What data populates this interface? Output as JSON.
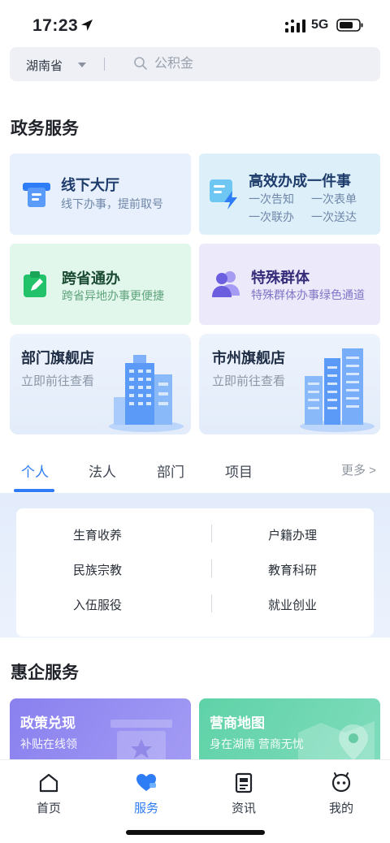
{
  "status_bar": {
    "time": "17:23",
    "network": "5G"
  },
  "search": {
    "region": "湖南省",
    "placeholder": "公积金"
  },
  "gov_services": {
    "title": "政务服务",
    "cards": [
      {
        "title": "线下大厅",
        "subtitle": "线下办事，提前取号",
        "icon": "ticket-machine-icon"
      },
      {
        "title": "高效办成一件事",
        "lines": [
          "一次告知",
          "一次表单",
          "一次联办",
          "一次送达"
        ],
        "icon": "lightning-document-icon"
      },
      {
        "title": "跨省通办",
        "subtitle": "跨省异地办事更便捷",
        "icon": "clipboard-pen-icon"
      },
      {
        "title": "特殊群体",
        "subtitle": "特殊群体办事绿色通道",
        "icon": "people-icon"
      },
      {
        "title": "部门旗舰店",
        "subtitle": "立即前往查看",
        "icon": "building-icon"
      },
      {
        "title": "市州旗舰店",
        "subtitle": "立即前往查看",
        "icon": "skyscraper-icon"
      }
    ]
  },
  "tabs": {
    "items": [
      "个人",
      "法人",
      "部门",
      "项目"
    ],
    "active": "个人",
    "more": "更多 >"
  },
  "categories": [
    "生育收养",
    "户籍办理",
    "民族宗教",
    "教育科研",
    "入伍服役",
    "就业创业"
  ],
  "enterprise": {
    "title": "惠企服务",
    "cards": [
      {
        "title": "政策兑现",
        "subtitle": "补贴在线领"
      },
      {
        "title": "营商地图",
        "subtitle": "身在湖南 营商无忧"
      }
    ]
  },
  "bottom_nav": {
    "items": [
      {
        "label": "首页",
        "icon": "home-icon"
      },
      {
        "label": "服务",
        "icon": "heart-service-icon"
      },
      {
        "label": "资讯",
        "icon": "news-icon"
      },
      {
        "label": "我的",
        "icon": "profile-icon"
      }
    ],
    "active": "服务"
  },
  "colors": {
    "accent": "#2e7cf6",
    "card_blue": "#e6f0fc",
    "card_cyan": "#e0f2fb",
    "card_green": "#e3f7ec",
    "card_purple": "#ece9fb",
    "promo_purple": "#8f86f0",
    "promo_green": "#5ed2aa"
  }
}
